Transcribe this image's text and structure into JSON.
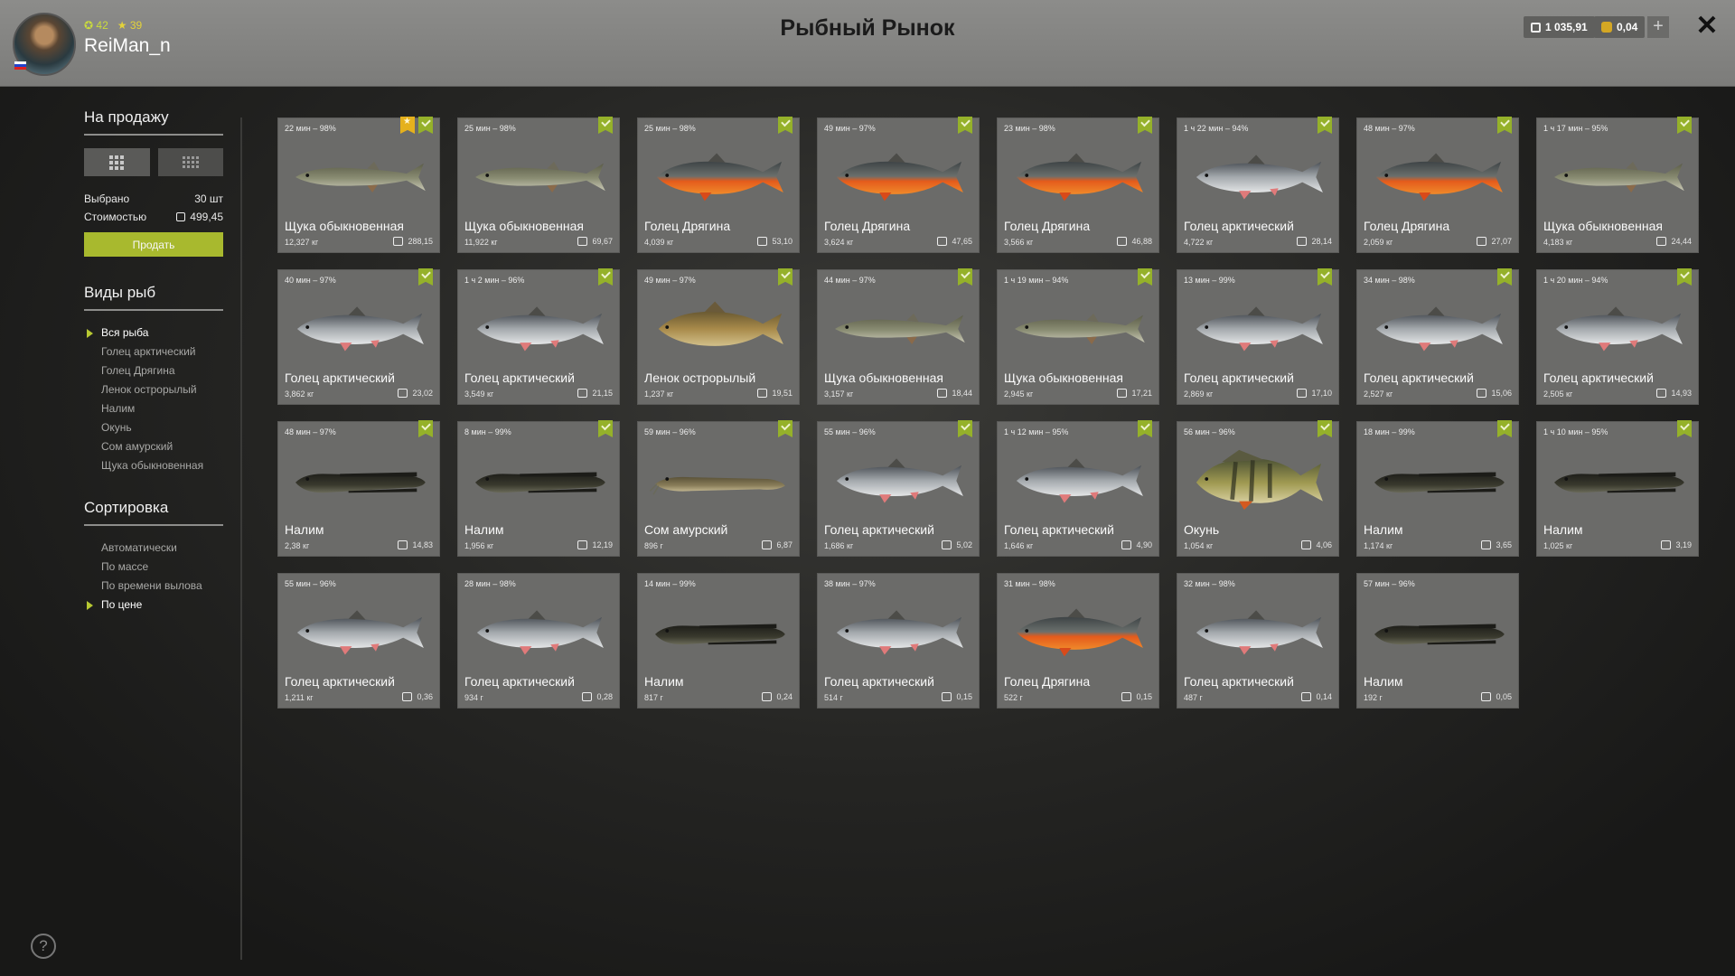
{
  "header": {
    "title": "Рыбный Рынок",
    "username": "ReiMan_n",
    "rank_level": "42",
    "rank_stars": "39",
    "silver": "1 035,91",
    "gold": "0,04",
    "plus_label": "+",
    "close_label": "✕"
  },
  "sidebar": {
    "sale_title": "На продажу",
    "selected_label": "Выбрано",
    "selected_value": "30 шт",
    "cost_label": "Стоимостью",
    "cost_value": "499,45",
    "sell_button": "Продать",
    "species_title": "Виды рыб",
    "species": [
      {
        "label": "Вся рыба",
        "active": true
      },
      {
        "label": "Голец арктический",
        "active": false
      },
      {
        "label": "Голец Дрягина",
        "active": false
      },
      {
        "label": "Ленок острорылый",
        "active": false
      },
      {
        "label": "Налим",
        "active": false
      },
      {
        "label": "Окунь",
        "active": false
      },
      {
        "label": "Сом амурский",
        "active": false
      },
      {
        "label": "Щука обыкновенная",
        "active": false
      }
    ],
    "sort_title": "Сортировка",
    "sort": [
      {
        "label": "Автоматически",
        "active": false
      },
      {
        "label": "По массе",
        "active": false
      },
      {
        "label": "По времени вылова",
        "active": false
      },
      {
        "label": "По цене",
        "active": true
      }
    ],
    "help_label": "?"
  },
  "colors": {
    "accent": "#a8b92e",
    "check": "#95b12a",
    "star": "#e5b11d"
  },
  "fish": [
    {
      "time": "22 мин – 98%",
      "name": "Щука обыкновенная",
      "weight": "12,327 кг",
      "price": "288,15",
      "kind": "pike",
      "checked": true,
      "starred": true
    },
    {
      "time": "25 мин – 98%",
      "name": "Щука обыкновенная",
      "weight": "11,922 кг",
      "price": "69,67",
      "kind": "pike",
      "checked": true,
      "starred": false
    },
    {
      "time": "25 мин – 98%",
      "name": "Голец Дрягина",
      "weight": "4,039 кг",
      "price": "53,10",
      "kind": "charr-red",
      "checked": true,
      "starred": false
    },
    {
      "time": "49 мин – 97%",
      "name": "Голец Дрягина",
      "weight": "3,624 кг",
      "price": "47,65",
      "kind": "charr-red",
      "checked": true,
      "starred": false
    },
    {
      "time": "23 мин – 98%",
      "name": "Голец Дрягина",
      "weight": "3,566 кг",
      "price": "46,88",
      "kind": "charr-red",
      "checked": true,
      "starred": false
    },
    {
      "time": "1 ч 22 мин – 94%",
      "name": "Голец арктический",
      "weight": "4,722 кг",
      "price": "28,14",
      "kind": "charr",
      "checked": true,
      "starred": false
    },
    {
      "time": "48 мин – 97%",
      "name": "Голец Дрягина",
      "weight": "2,059 кг",
      "price": "27,07",
      "kind": "charr-red",
      "checked": true,
      "starred": false
    },
    {
      "time": "1 ч 17 мин – 95%",
      "name": "Щука обыкновенная",
      "weight": "4,183 кг",
      "price": "24,44",
      "kind": "pike",
      "checked": true,
      "starred": false
    },
    {
      "time": "40 мин – 97%",
      "name": "Голец арктический",
      "weight": "3,862 кг",
      "price": "23,02",
      "kind": "charr",
      "checked": true,
      "starred": false
    },
    {
      "time": "1 ч 2 мин – 96%",
      "name": "Голец арктический",
      "weight": "3,549 кг",
      "price": "21,15",
      "kind": "charr",
      "checked": true,
      "starred": false
    },
    {
      "time": "49 мин – 97%",
      "name": "Ленок острорылый",
      "weight": "1,237 кг",
      "price": "19,51",
      "kind": "lenok",
      "checked": true,
      "starred": false
    },
    {
      "time": "44 мин – 97%",
      "name": "Щука обыкновенная",
      "weight": "3,157 кг",
      "price": "18,44",
      "kind": "pike",
      "checked": true,
      "starred": false
    },
    {
      "time": "1 ч 19 мин – 94%",
      "name": "Щука обыкновенная",
      "weight": "2,945 кг",
      "price": "17,21",
      "kind": "pike",
      "checked": true,
      "starred": false
    },
    {
      "time": "13 мин – 99%",
      "name": "Голец арктический",
      "weight": "2,869 кг",
      "price": "17,10",
      "kind": "charr",
      "checked": true,
      "starred": false
    },
    {
      "time": "34 мин – 98%",
      "name": "Голец арктический",
      "weight": "2,527 кг",
      "price": "15,06",
      "kind": "charr",
      "checked": true,
      "starred": false
    },
    {
      "time": "1 ч 20 мин – 94%",
      "name": "Голец арктический",
      "weight": "2,505 кг",
      "price": "14,93",
      "kind": "charr",
      "checked": true,
      "starred": false
    },
    {
      "time": "48 мин – 97%",
      "name": "Налим",
      "weight": "2,38 кг",
      "price": "14,83",
      "kind": "burbot",
      "checked": true,
      "starred": false
    },
    {
      "time": "8 мин – 99%",
      "name": "Налим",
      "weight": "1,956 кг",
      "price": "12,19",
      "kind": "burbot",
      "checked": true,
      "starred": false
    },
    {
      "time": "59 мин – 96%",
      "name": "Сом амурский",
      "weight": "896 г",
      "price": "6,87",
      "kind": "catfish",
      "checked": true,
      "starred": false
    },
    {
      "time": "55 мин – 96%",
      "name": "Голец арктический",
      "weight": "1,686 кг",
      "price": "5,02",
      "kind": "charr",
      "checked": true,
      "starred": false
    },
    {
      "time": "1 ч 12 мин – 95%",
      "name": "Голец арктический",
      "weight": "1,646 кг",
      "price": "4,90",
      "kind": "charr",
      "checked": true,
      "starred": false
    },
    {
      "time": "56 мин – 96%",
      "name": "Окунь",
      "weight": "1,054 кг",
      "price": "4,06",
      "kind": "perch",
      "checked": true,
      "starred": false
    },
    {
      "time": "18 мин – 99%",
      "name": "Налим",
      "weight": "1,174 кг",
      "price": "3,65",
      "kind": "burbot",
      "checked": true,
      "starred": false
    },
    {
      "time": "1 ч 10 мин – 95%",
      "name": "Налим",
      "weight": "1,025 кг",
      "price": "3,19",
      "kind": "burbot",
      "checked": true,
      "starred": false
    },
    {
      "time": "55 мин – 96%",
      "name": "Голец арктический",
      "weight": "1,211 кг",
      "price": "0,36",
      "kind": "charr",
      "checked": false,
      "starred": false
    },
    {
      "time": "28 мин – 98%",
      "name": "Голец арктический",
      "weight": "934 г",
      "price": "0,28",
      "kind": "charr",
      "checked": false,
      "starred": false
    },
    {
      "time": "14 мин – 99%",
      "name": "Налим",
      "weight": "817 г",
      "price": "0,24",
      "kind": "burbot",
      "checked": false,
      "starred": false
    },
    {
      "time": "38 мин – 97%",
      "name": "Голец арктический",
      "weight": "514 г",
      "price": "0,15",
      "kind": "charr",
      "checked": false,
      "starred": false
    },
    {
      "time": "31 мин – 98%",
      "name": "Голец Дрягина",
      "weight": "522 г",
      "price": "0,15",
      "kind": "charr-red",
      "checked": false,
      "starred": false
    },
    {
      "time": "32 мин – 98%",
      "name": "Голец арктический",
      "weight": "487 г",
      "price": "0,14",
      "kind": "charr",
      "checked": false,
      "starred": false
    },
    {
      "time": "57 мин – 96%",
      "name": "Налим",
      "weight": "192 г",
      "price": "0,05",
      "kind": "burbot",
      "checked": false,
      "starred": false
    }
  ]
}
